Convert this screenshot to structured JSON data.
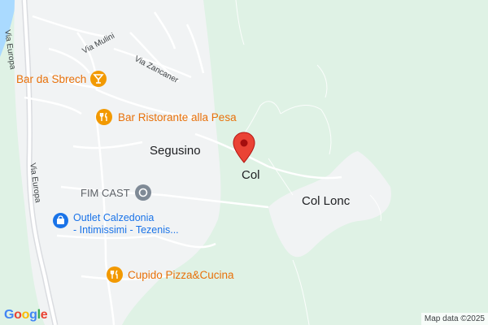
{
  "map": {
    "road_labels": {
      "via_europa_top": "Via Europa",
      "via_europa_left": "Via Europa",
      "via_mulini": "Via Mulini",
      "via_zancaner": "Via Zancaner"
    },
    "places": {
      "segusino": "Segusino",
      "col": "Col",
      "col_lonc": "Col Lonc"
    },
    "pois": {
      "bar_da_sbrech": "Bar da Sbrech",
      "bar_ristorante": "Bar Ristorante alla Pesa",
      "fim_cast": "FIM CAST",
      "outlet_line1": "Outlet Calzedonia",
      "outlet_line2": "- Intimissimi - Tezenis...",
      "cupido": "Cupido Pizza&Cucina"
    },
    "attribution": "Map data ©2025",
    "logo": "Google",
    "colors": {
      "forest": "#dff2e5",
      "builtup": "#f1f3f4",
      "road": "#ffffff",
      "highway": "#dadce0",
      "water": "#aadaff",
      "pin_red": "#ea4335",
      "food_orange": "#f29900",
      "shop_blue": "#1a73e8"
    }
  }
}
